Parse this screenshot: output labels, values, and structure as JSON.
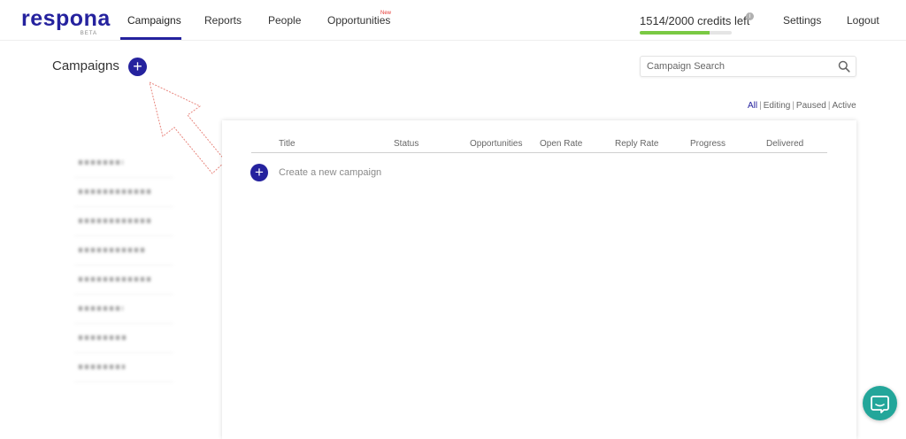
{
  "brand": {
    "name": "respona",
    "badge": "BETA",
    "color": "#25229e"
  },
  "nav": {
    "campaigns": "Campaigns",
    "reports": "Reports",
    "people": "People",
    "opportunities": "Opportunities",
    "opportunities_badge": "New",
    "settings": "Settings",
    "logout": "Logout"
  },
  "credits": {
    "label": "1514/2000 credits left",
    "used": 1514,
    "total": 2000,
    "fill_fraction": 0.76,
    "bar_color": "#7ac943"
  },
  "page": {
    "title": "Campaigns"
  },
  "search": {
    "placeholder": "Campaign Search",
    "value": ""
  },
  "filters": {
    "all": "All",
    "editing": "Editing",
    "paused": "Paused",
    "active": "Active",
    "selected": "All",
    "separator": "|"
  },
  "table": {
    "columns": [
      "Title",
      "Status",
      "Opportunities",
      "Open Rate",
      "Reply Rate",
      "Progress",
      "Delivered"
    ],
    "create_label": "Create a new campaign"
  },
  "icons": {
    "add": "plus-circle-icon",
    "search": "magnifier-icon",
    "chat": "chat-bubble-icon",
    "info": "info-icon",
    "annotation": "arrow-annotation"
  },
  "colors": {
    "accent": "#25229e",
    "chat": "#23a69a",
    "new_badge": "#e53935"
  }
}
